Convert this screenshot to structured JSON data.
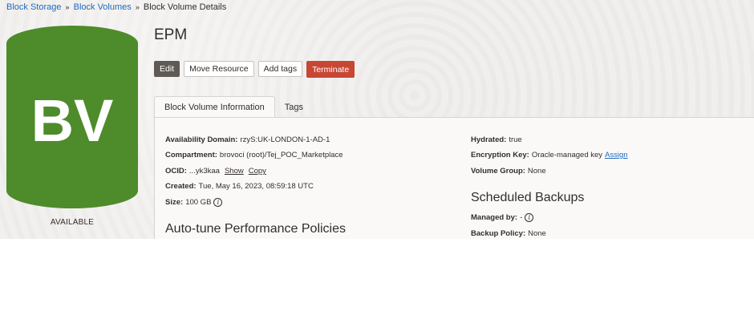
{
  "breadcrumb": {
    "items": [
      "Block Storage",
      "Block Volumes"
    ],
    "separator": "»",
    "current": "Block Volume Details"
  },
  "badge": {
    "text": "BV",
    "color": "#4e8b2b",
    "status": "AVAILABLE"
  },
  "page": {
    "title": "EPM"
  },
  "actions": {
    "edit": "Edit",
    "move": "Move Resource",
    "tags": "Add tags",
    "terminate": "Terminate"
  },
  "tabs": [
    "Block Volume Information",
    "Tags"
  ],
  "info_left": {
    "availability_domain": {
      "label": "Availability Domain:",
      "value": "rzyS:UK-LONDON-1-AD-1"
    },
    "compartment": {
      "label": "Compartment:",
      "value": "brovoci (root)/Tej_POC_Marketplace"
    },
    "ocid": {
      "label": "OCID:",
      "value": "...yk3kaa",
      "show": "Show",
      "copy": "Copy"
    },
    "created": {
      "label": "Created:",
      "value": "Tue, May 16, 2023, 08:59:18 UTC"
    },
    "size": {
      "label": "Size:",
      "value": "100 GB"
    }
  },
  "info_right": {
    "hydrated": {
      "label": "Hydrated:",
      "value": "true"
    },
    "encryption": {
      "label": "Encryption Key:",
      "value": "Oracle-managed key",
      "action": "Assign"
    },
    "volume_group": {
      "label": "Volume Group:",
      "value": "None"
    }
  },
  "sections": {
    "autotune": "Auto-tune Performance Policies",
    "backups": "Scheduled Backups"
  },
  "backups": {
    "managed_by": {
      "label": "Managed by:",
      "value": "-"
    },
    "policy": {
      "label": "Backup Policy:",
      "value": "None"
    }
  },
  "icons": {
    "info": "info-icon",
    "separator": "chevron-right-icon"
  },
  "colors": {
    "link": "#1e6bbd",
    "terminate": "#c74634",
    "edit": "#5f5a56"
  }
}
